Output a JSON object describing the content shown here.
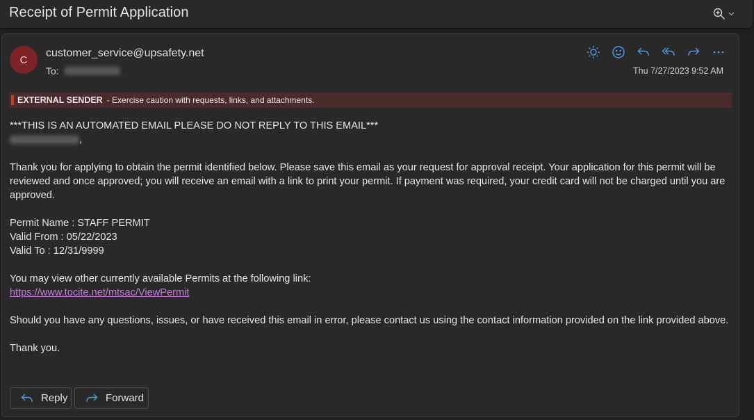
{
  "window": {
    "title": "Receipt of Permit Application",
    "zoom_icon": "zoom-in-icon",
    "zoom_dropdown_icon": "chevron-down-icon"
  },
  "colors": {
    "accent": "#4c9be8",
    "avatar_bg": "#7d2326",
    "banner_bg": "#4a2b2b",
    "banner_bar": "#c4420f",
    "link": "#c57ce0"
  },
  "message": {
    "avatar_initial": "C",
    "sender": "customer_service@upsafety.net",
    "to_label": "To:",
    "recipient_redacted": true,
    "timestamp": "Thu 7/27/2023 9:52 AM",
    "actions": [
      {
        "name": "immersive-reader",
        "icon": "sun-icon"
      },
      {
        "name": "reactions",
        "icon": "smiley-icon"
      },
      {
        "name": "reply",
        "icon": "reply-icon"
      },
      {
        "name": "reply-all",
        "icon": "reply-all-icon"
      },
      {
        "name": "forward",
        "icon": "forward-icon"
      },
      {
        "name": "more",
        "icon": "more-icon"
      }
    ]
  },
  "banner": {
    "label": "EXTERNAL SENDER",
    "text": "- Exercise caution with requests, links, and attachments."
  },
  "body": {
    "automated_notice": "***THIS IS AN AUTOMATED EMAIL PLEASE DO NOT REPLY TO THIS EMAIL***",
    "greeting_suffix": ",",
    "paragraph1": "Thank you for applying to obtain the permit identified below. Please save this email as your request for approval receipt. Your application for this permit will be reviewed and once approved; you will receive an email with a link to print your permit. If payment was required, your credit card will not be charged until you are approved.",
    "permit_name": "Permit Name : STAFF PERMIT",
    "valid_from": "Valid From : 05/22/2023",
    "valid_to": "Valid To : 12/31/9999",
    "link_intro": "You may view other currently available Permits at the following link:",
    "link": "https://www.tocite.net/mtsac/ViewPermit",
    "paragraph2": "Should you have any questions, issues, or have received this email in error, please contact us using the contact information provided on the link provided above.",
    "closing": "Thank you."
  },
  "buttons": {
    "reply": "Reply",
    "forward": "Forward"
  }
}
